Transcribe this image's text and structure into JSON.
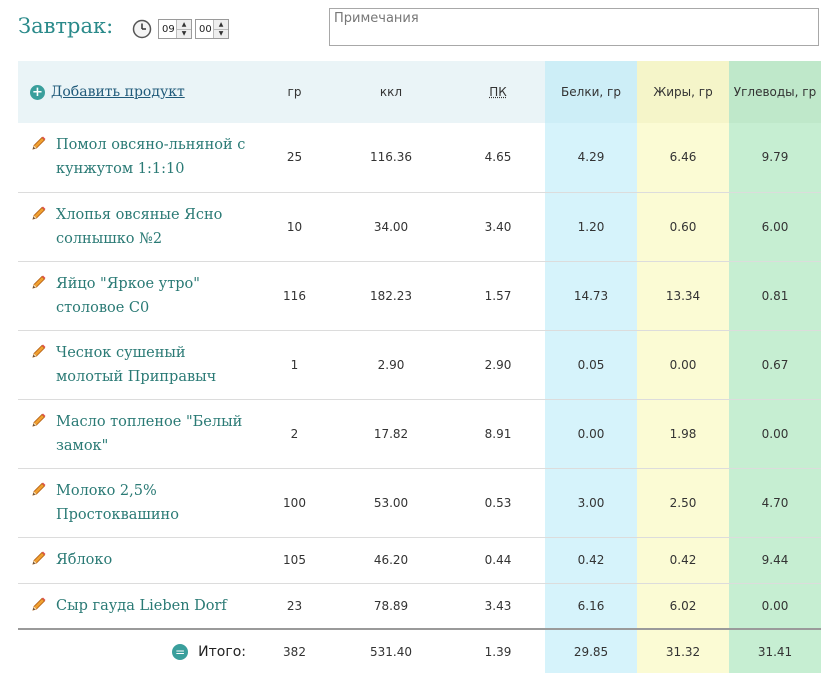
{
  "meal": {
    "title": "Завтрак:",
    "hour": "09",
    "minute": "00",
    "notes_placeholder": "Примечания"
  },
  "header": {
    "add_label": "Добавить продукт",
    "col_gr": "гр",
    "col_kcal": "ккл",
    "col_pk": "ПК",
    "col_protein": "Белки, гр",
    "col_fat": "Жиры, гр",
    "col_carbs": "Углеводы, гр"
  },
  "items": [
    {
      "name": "Помол овсяно-льняной с кунжутом 1:1:10",
      "gr": "25",
      "kcal": "116.36",
      "pk": "4.65",
      "protein": "4.29",
      "fat": "6.46",
      "carbs": "9.79"
    },
    {
      "name": "Хлопья овсяные Ясно солнышко №2",
      "gr": "10",
      "kcal": "34.00",
      "pk": "3.40",
      "protein": "1.20",
      "fat": "0.60",
      "carbs": "6.00"
    },
    {
      "name": "Яйцо \"Яркое утро\" столовое С0",
      "gr": "116",
      "kcal": "182.23",
      "pk": "1.57",
      "protein": "14.73",
      "fat": "13.34",
      "carbs": "0.81"
    },
    {
      "name": "Чеснок сушеный молотый Приправыч",
      "gr": "1",
      "kcal": "2.90",
      "pk": "2.90",
      "protein": "0.05",
      "fat": "0.00",
      "carbs": "0.67"
    },
    {
      "name": "Масло топленое \"Белый замок\"",
      "gr": "2",
      "kcal": "17.82",
      "pk": "8.91",
      "protein": "0.00",
      "fat": "1.98",
      "carbs": "0.00"
    },
    {
      "name": "Молоко 2,5% Простоквашино",
      "gr": "100",
      "kcal": "53.00",
      "pk": "0.53",
      "protein": "3.00",
      "fat": "2.50",
      "carbs": "4.70"
    },
    {
      "name": "Яблоко",
      "gr": "105",
      "kcal": "46.20",
      "pk": "0.44",
      "protein": "0.42",
      "fat": "0.42",
      "carbs": "9.44"
    },
    {
      "name": "Сыр гауда Lieben Dorf",
      "gr": "23",
      "kcal": "78.89",
      "pk": "3.43",
      "protein": "6.16",
      "fat": "6.02",
      "carbs": "0.00"
    }
  ],
  "totals": {
    "label": "Итого:",
    "gr": "382",
    "kcal": "531.40",
    "pk": "1.39",
    "protein": "29.85",
    "fat": "31.32",
    "carbs": "31.41"
  }
}
